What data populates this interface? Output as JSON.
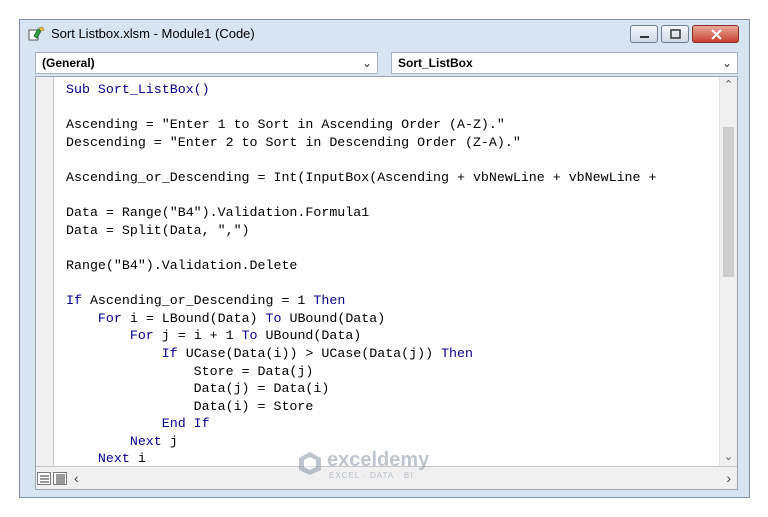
{
  "window": {
    "title": "Sort Listbox.xlsm - Module1 (Code)"
  },
  "combos": {
    "object": "(General)",
    "procedure": "Sort_ListBox"
  },
  "code": {
    "lines": [
      [
        {
          "t": "Sub Sort_ListBox()",
          "k": true
        }
      ],
      [],
      [
        {
          "t": "Ascending = \"Enter 1 to Sort in Ascending Order (A-Z).\""
        }
      ],
      [
        {
          "t": "Descending = \"Enter 2 to Sort in Descending Order (Z-A).\""
        }
      ],
      [],
      [
        {
          "t": "Ascending_or_Descending = Int(InputBox(Ascending + vbNewLine + vbNewLine +"
        }
      ],
      [],
      [
        {
          "t": "Data = Range(\"B4\").Validation.Formula1"
        }
      ],
      [
        {
          "t": "Data = Split(Data, \",\")"
        }
      ],
      [],
      [
        {
          "t": "Range(\"B4\").Validation.Delete"
        }
      ],
      [],
      [
        {
          "t": "If",
          "k": true
        },
        {
          "t": " Ascending_or_Descending = 1 "
        },
        {
          "t": "Then",
          "k": true
        }
      ],
      [
        {
          "t": "    "
        },
        {
          "t": "For",
          "k": true
        },
        {
          "t": " i = LBound(Data) "
        },
        {
          "t": "To",
          "k": true
        },
        {
          "t": " UBound(Data)"
        }
      ],
      [
        {
          "t": "        "
        },
        {
          "t": "For",
          "k": true
        },
        {
          "t": " j = i + 1 "
        },
        {
          "t": "To",
          "k": true
        },
        {
          "t": " UBound(Data)"
        }
      ],
      [
        {
          "t": "            "
        },
        {
          "t": "If",
          "k": true
        },
        {
          "t": " UCase(Data(i)) > UCase(Data(j)) "
        },
        {
          "t": "Then",
          "k": true
        }
      ],
      [
        {
          "t": "                Store = Data(j)"
        }
      ],
      [
        {
          "t": "                Data(j) = Data(i)"
        }
      ],
      [
        {
          "t": "                Data(i) = Store"
        }
      ],
      [
        {
          "t": "            "
        },
        {
          "t": "End If",
          "k": true
        }
      ],
      [
        {
          "t": "        "
        },
        {
          "t": "Next",
          "k": true
        },
        {
          "t": " j"
        }
      ],
      [
        {
          "t": "    "
        },
        {
          "t": "Next",
          "k": true
        },
        {
          "t": " i"
        }
      ]
    ]
  },
  "watermark": {
    "name": "exceldemy",
    "tagline": "EXCEL · DATA · BI"
  },
  "colors": {
    "keyword": "#00008b",
    "window_frame": "#d7e4f2",
    "close_button": "#c7402d"
  },
  "icons": {
    "title": "vba-module-icon",
    "minimize": "minimize-icon",
    "maximize": "maximize-icon",
    "close": "close-icon"
  }
}
